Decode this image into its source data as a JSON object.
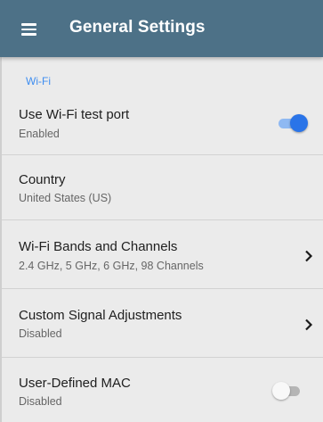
{
  "app_bar": {
    "title": "General Settings",
    "menu_icon": "hamburger-menu-icon",
    "background_color": "#4d7187"
  },
  "section": {
    "header": "Wi-Fi",
    "header_color": "#3f8ef0"
  },
  "rows": [
    {
      "title": "Use Wi-Fi test port",
      "subtitle": "Enabled",
      "control": "toggle",
      "toggle_on": true
    },
    {
      "title": "Country",
      "subtitle": "United States (US)",
      "control": "none"
    },
    {
      "title": "Wi-Fi Bands and Channels",
      "subtitle": "2.4 GHz, 5 GHz, 6 GHz, 98 Channels",
      "control": "chevron",
      "icon": "chevron-right-icon"
    },
    {
      "title": "Custom Signal Adjustments",
      "subtitle": "Disabled",
      "control": "chevron",
      "icon": "chevron-right-icon"
    },
    {
      "title": "User-Defined MAC",
      "subtitle": "Disabled",
      "control": "toggle",
      "toggle_on": false
    }
  ],
  "colors": {
    "toggle_on_knob": "#2a74e8",
    "toggle_on_track": "#8fb9f2",
    "toggle_off_knob": "#f8f8f8",
    "toggle_off_track": "#b5b5b5"
  }
}
